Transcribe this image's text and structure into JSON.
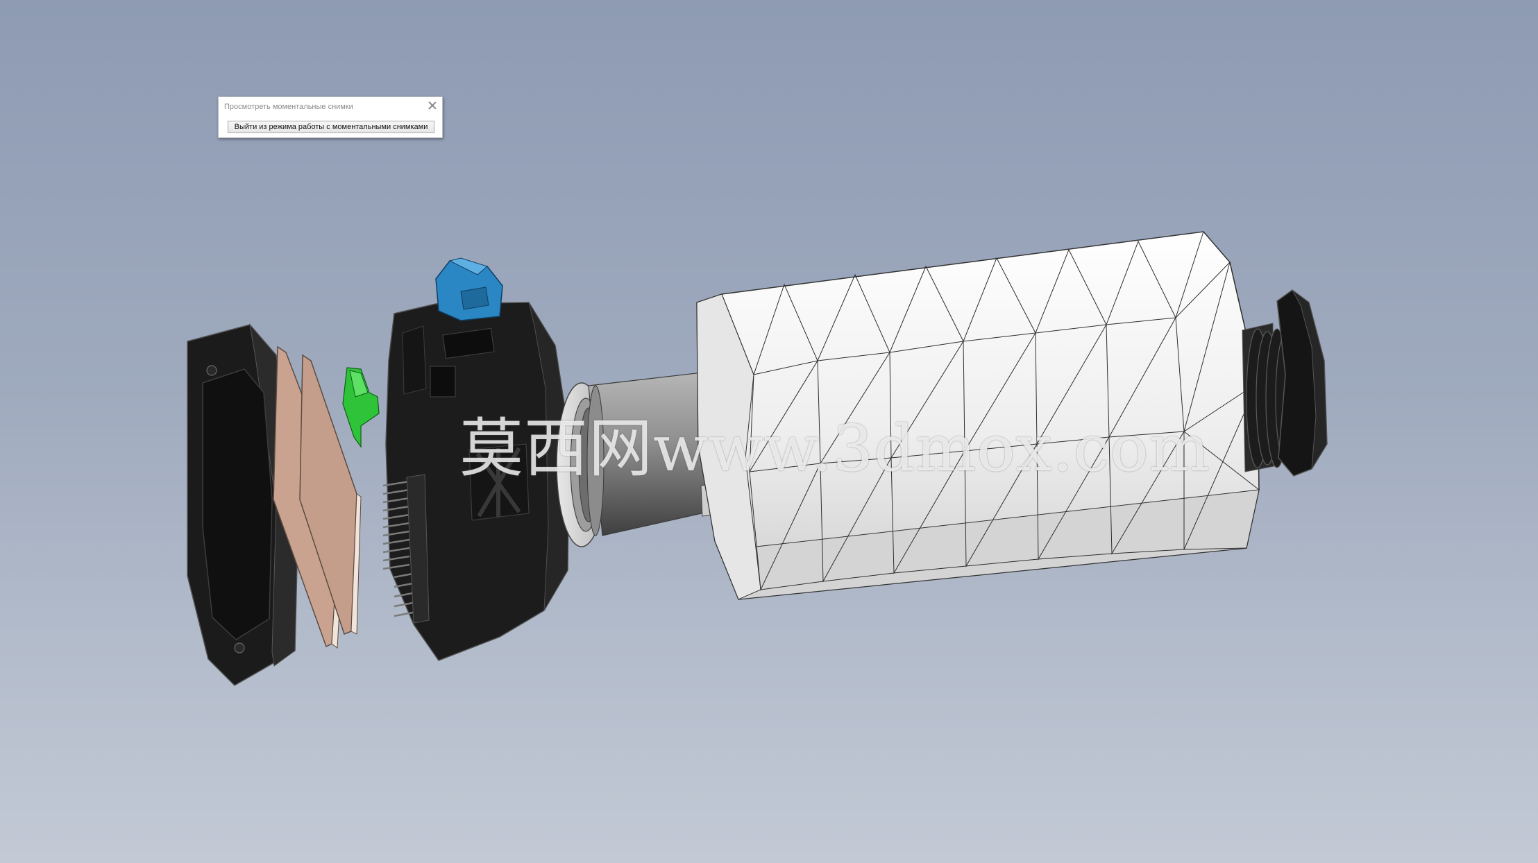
{
  "snapshot_dialog": {
    "title": "Просмотреть моментальные снимки",
    "exit_button_label": "Выйти из режима работы с моментальными снимками"
  },
  "watermark": {
    "text": "莫西网www.3dmox.com"
  },
  "icons": {
    "close": "close-icon"
  },
  "colors": {
    "background_top": "#8e9bb3",
    "background_bottom": "#c3cad6",
    "body_dark": "#1c1c1c",
    "switch_blue": "#2a87c4",
    "clip_green": "#2fc33a",
    "board_tan": "#c9a390",
    "sleeve_white": "#f2f2f2",
    "shaft_gray": "#9a9a9a"
  }
}
